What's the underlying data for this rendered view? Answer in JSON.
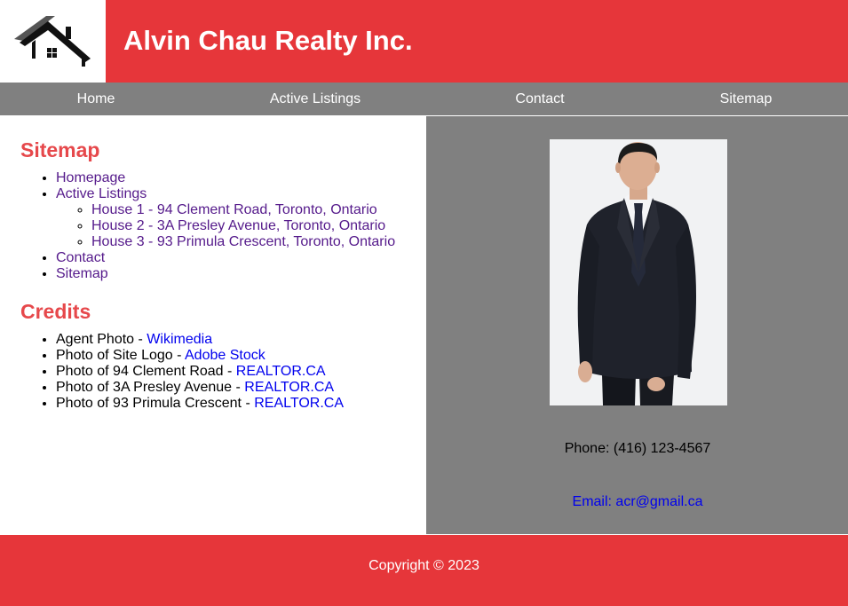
{
  "header": {
    "logo_icon": "house-roof-icon",
    "title": "Alvin Chau Realty Inc."
  },
  "nav": {
    "items": [
      "Home",
      "Active Listings",
      "Contact",
      "Sitemap"
    ]
  },
  "sitemap": {
    "heading": "Sitemap",
    "items": {
      "homepage": "Homepage",
      "active_listings": "Active Listings",
      "houses": [
        "House 1 - 94 Clement Road, Toronto, Ontario",
        "House 2 - 3A Presley Avenue, Toronto, Ontario",
        "House 3 - 93 Primula Crescent, Toronto, Ontario"
      ],
      "contact": "Contact",
      "sitemap": "Sitemap"
    }
  },
  "credits": {
    "heading": "Credits",
    "items": [
      {
        "label": "Agent Photo - ",
        "link": "Wikimedia"
      },
      {
        "label": "Photo of Site Logo - ",
        "link": "Adobe Stock"
      },
      {
        "label": "Photo of 94 Clement Road - ",
        "link": "REALTOR.CA"
      },
      {
        "label": "Photo of 3A Presley Avenue - ",
        "link": "REALTOR.CA"
      },
      {
        "label": "Photo of 93 Primula Crescent - ",
        "link": "REALTOR.CA"
      }
    ]
  },
  "contact_panel": {
    "phone": "Phone: (416) 123-4567",
    "email": "Email: acr@gmail.ca"
  },
  "footer": {
    "copyright": "Copyright © 2023"
  },
  "colors": {
    "brand_red": "#e6363a",
    "nav_gray": "#808080",
    "heading_red": "#e6484b",
    "visited_link": "#551a8b",
    "link": "#0000ee"
  }
}
